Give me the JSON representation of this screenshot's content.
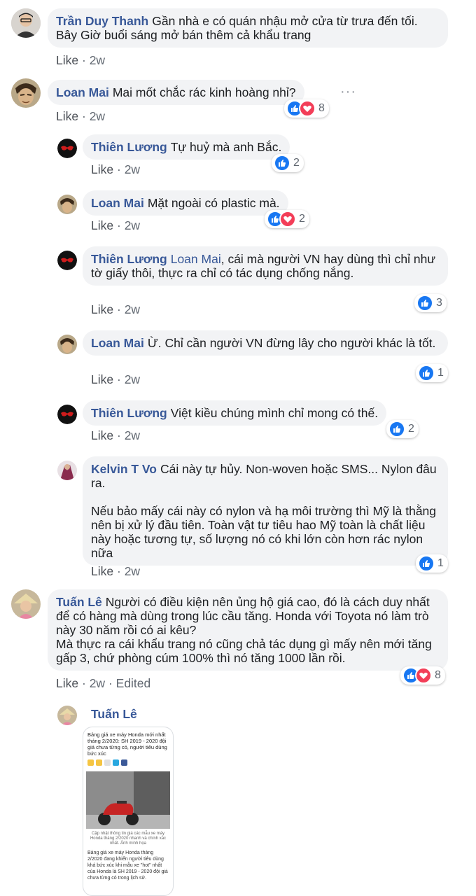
{
  "comments": [
    {
      "name": "Trần Duy Thanh",
      "text": "Gần nhà e có quán nhậu mở cửa từ trưa đến tối. Bây Giờ buổi sáng mở bán thêm cả khẩu trang",
      "like": "Like",
      "time": "2w"
    },
    {
      "name": "Loan Mai",
      "text": "Mai mốt chắc rác kinh hoàng nhỉ?",
      "like": "Like",
      "time": "2w",
      "reactions": "8"
    },
    {
      "name": "Thiên Lương",
      "text": "Tự huỷ mà anh Bắc.",
      "like": "Like",
      "time": "2w",
      "reactions": "2"
    },
    {
      "name": "Loan Mai",
      "text": "Mặt ngoài có plastic mà.",
      "like": "Like",
      "time": "2w",
      "reactions": "2"
    },
    {
      "name": "Thiên Lương",
      "mention": "Loan Mai",
      "text": ", cái mà người VN hay dùng thì chỉ như tờ giấy thôi, thực ra chỉ có tác dụng chống nắng.",
      "like": "Like",
      "time": "2w",
      "reactions": "3"
    },
    {
      "name": "Loan Mai",
      "text": "Ừ. Chỉ cần người VN đừng lây cho người khác là tốt.",
      "like": "Like",
      "time": "2w",
      "reactions": "1"
    },
    {
      "name": "Thiên Lương",
      "text": "Việt kiều chúng mình chỉ mong có thế.",
      "like": "Like",
      "time": "2w",
      "reactions": "2"
    },
    {
      "name": "Kelvin T Vo",
      "text": "Cái này tự hủy. Non-woven hoặc SMS... Nylon đâu ra.",
      "text2": "Nếu bảo mấy cái này có nylon và hạ môi trường thì Mỹ là thằng nên bị xử lý đầu tiên. Toàn vật tư tiêu hao Mỹ toàn là chất liệu này hoặc tương tự, số lượng nó có khi lớn còn hơn rác nylon nữa",
      "like": "Like",
      "time": "2w",
      "reactions": "1"
    },
    {
      "name": "Tuấn Lê",
      "text": "Người có điều kiện nên ủng hộ giá cao, đó là cách duy nhất để có hàng mà dùng trong lúc cầu tăng. Honda với Toyota nó làm trò này 30 năm rồi có ai kêu?",
      "text2": "Mà thực ra cái khẩu trang nó cũng chả tác dụng gì mấy nên mới tăng gấp 3, chứ phòng cúm 100% thì nó tăng 1000 lần rồi.",
      "like": "Like",
      "time": "2w",
      "edited": "Edited",
      "reactions": "8"
    },
    {
      "name": "Tuấn Lê"
    }
  ],
  "separator": "·",
  "more": "···",
  "attachment": {
    "headline": "Bảng giá xe máy Honda mới nhất tháng 2/2020: SH 2019 - 2020 đội giá chưa từng có, người tiêu dùng bức xúc",
    "caption": "Cập nhật thông tin giá các mẫu xe máy Honda tháng 2/2020 nhanh và chính xác nhất. Ảnh minh họa",
    "body": "Bảng giá xe máy Honda tháng 2/2020 đang khiến người tiêu dùng khá bức xúc khi mẫu xe \"hot\" nhất của Honda là SH 2019 - 2020 đội giá chưa từng có trong lịch sử."
  },
  "colors": {
    "like_blue": "#1877f2",
    "love_red": "#f33e58",
    "name": "#385898",
    "bubble": "#f2f3f5"
  }
}
